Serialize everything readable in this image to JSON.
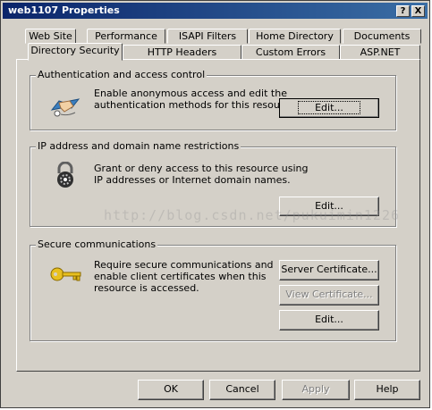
{
  "window": {
    "title": "web1107 Properties",
    "help_btn": "?",
    "close_btn": "X"
  },
  "tabs_row1": [
    "Web Site",
    "Performance",
    "ISAPI Filters",
    "Home Directory",
    "Documents"
  ],
  "tabs_row2": [
    "Directory Security",
    "HTTP Headers",
    "Custom Errors",
    "ASP.NET"
  ],
  "active_tab": "Directory Security",
  "auth": {
    "legend": "Authentication and access control",
    "text": "Enable anonymous access and edit the\nauthentication methods for this resource.",
    "edit_label": "Edit...",
    "icon": "handshake-icon"
  },
  "ip": {
    "legend": "IP address and domain name restrictions",
    "text": "Grant or deny access to this resource using\nIP addresses or Internet domain names.",
    "edit_label": "Edit...",
    "icon": "padlock-icon"
  },
  "secure": {
    "legend": "Secure communications",
    "text": "Require secure communications and\nenable client certificates when this\nresource is accessed.",
    "server_cert_label": "Server Certificate...",
    "view_cert_label": "View Certificate...",
    "edit_label": "Edit...",
    "icon": "key-icon"
  },
  "watermark": "http://blog.csdn.net/pukuimin1226",
  "footer": {
    "ok": "OK",
    "cancel": "Cancel",
    "apply": "Apply",
    "help": "Help"
  },
  "colors": {
    "title_start": "#0a246a",
    "title_end": "#3a6ea5",
    "face": "#d4d0c8"
  }
}
